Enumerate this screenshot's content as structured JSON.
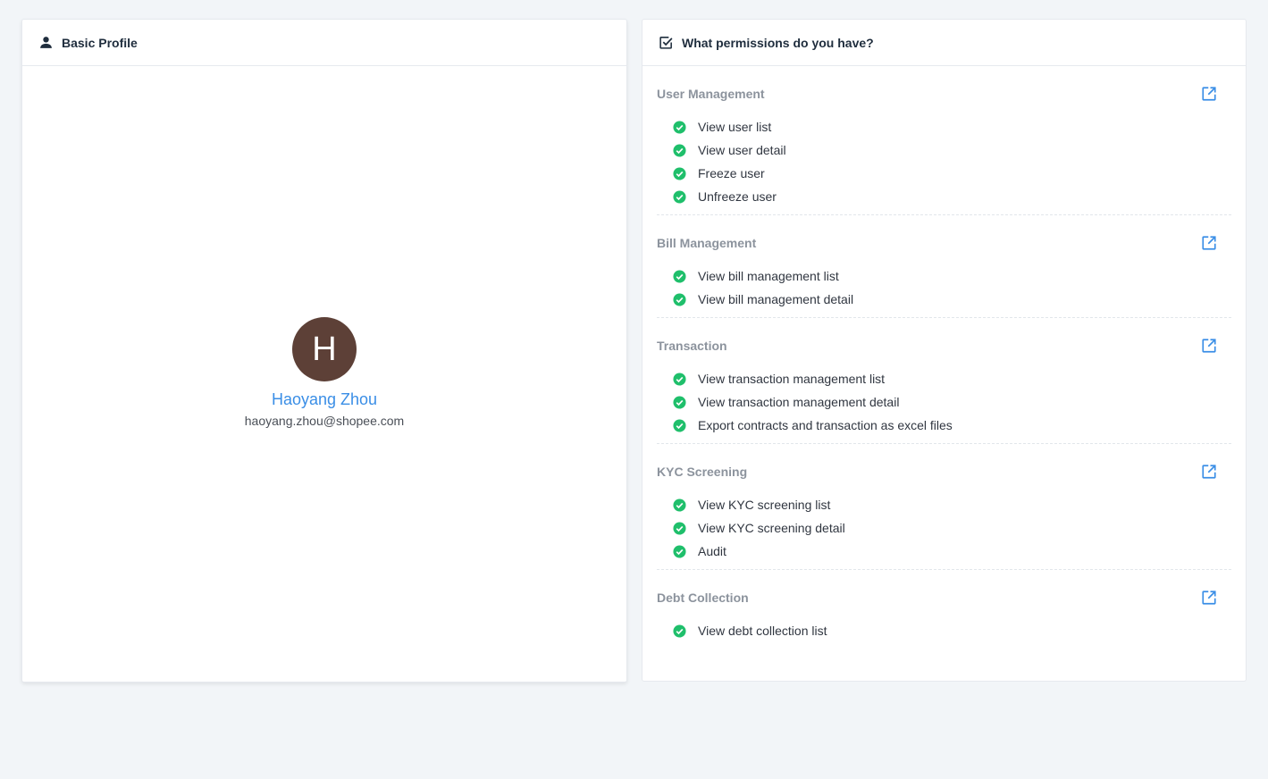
{
  "profile": {
    "header": "Basic Profile",
    "avatar_letter": "H",
    "avatar_color": "#5d4037",
    "name": "Haoyang Zhou",
    "email": "haoyang.zhou@shopee.com"
  },
  "permissions": {
    "header": "What permissions do you have?",
    "accent": "#3a8ee6",
    "check_color": "#1fbf6b",
    "sections": [
      {
        "title": "User Management",
        "items": [
          "View user list",
          "View user detail",
          "Freeze user",
          "Unfreeze user"
        ]
      },
      {
        "title": "Bill Management",
        "items": [
          "View bill management list",
          "View bill management detail"
        ]
      },
      {
        "title": "Transaction",
        "items": [
          "View transaction management list",
          "View transaction management detail",
          "Export contracts and transaction as excel files"
        ]
      },
      {
        "title": "KYC Screening",
        "items": [
          "View KYC screening list",
          "View KYC screening detail",
          "Audit"
        ]
      },
      {
        "title": "Debt Collection",
        "items": [
          "View debt collection list"
        ]
      }
    ]
  }
}
